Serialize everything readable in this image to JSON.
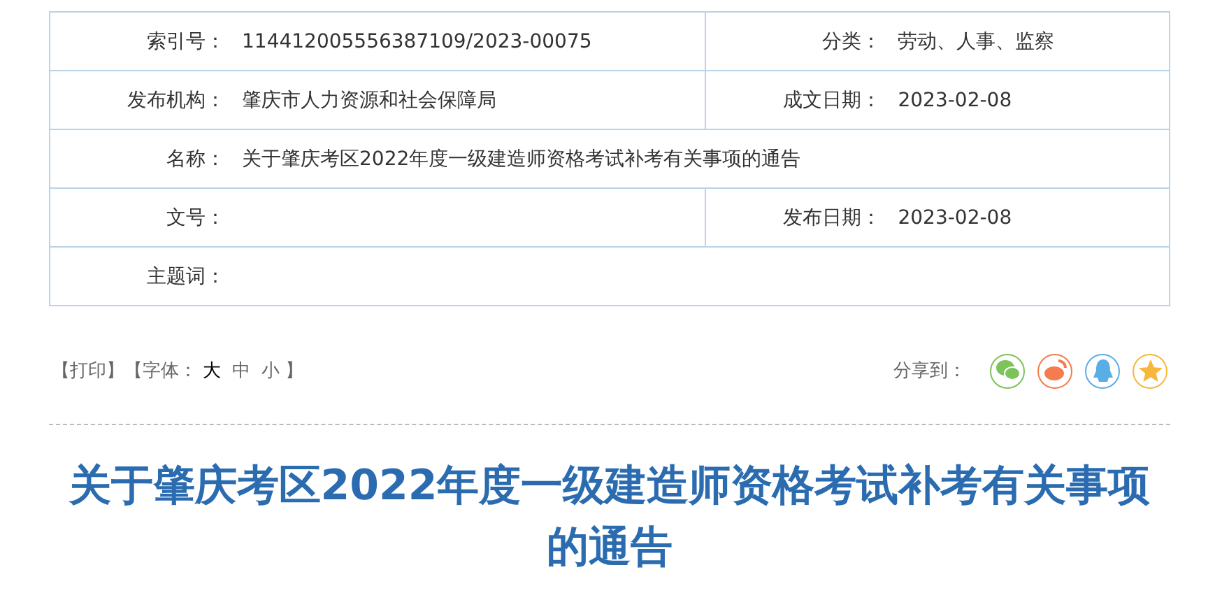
{
  "info_table": {
    "rows": [
      {
        "kind": "pair",
        "cells": [
          {
            "label": "索引号：",
            "value": "114412005556387109/2023-00075"
          },
          {
            "label": "分类：",
            "value": "劳动、人事、监察"
          }
        ]
      },
      {
        "kind": "pair",
        "cells": [
          {
            "label": "发布机构：",
            "value": "肇庆市人力资源和社会保障局"
          },
          {
            "label": "成文日期：",
            "value": "2023-02-08"
          }
        ]
      },
      {
        "kind": "full",
        "cells": [
          {
            "label": "名称：",
            "value": "关于肇庆考区2022年度一级建造师资格考试补考有关事项的通告"
          }
        ]
      },
      {
        "kind": "pair",
        "cells": [
          {
            "label": "文号："
          },
          {
            "label": "发布日期：",
            "value": "2023-02-08"
          }
        ]
      },
      {
        "kind": "full",
        "cells": [
          {
            "label": "主题词："
          }
        ]
      }
    ]
  },
  "tools": {
    "print": "【打印】",
    "font_open": "【字体：",
    "font_sizes": [
      {
        "label": "大",
        "selected": true
      },
      {
        "label": "中",
        "selected": false
      },
      {
        "label": "小",
        "selected": false
      }
    ],
    "font_close": "】"
  },
  "share": {
    "label": "分享到：",
    "targets": [
      {
        "kind": "wechat",
        "color": "#7cc35a"
      },
      {
        "kind": "weibo",
        "color": "#f47c4e"
      },
      {
        "kind": "qq",
        "color": "#5aaee6"
      },
      {
        "kind": "favorite",
        "color": "#f6b73c"
      }
    ]
  },
  "article": {
    "title": "关于肇庆考区2022年度一级建造师资格考试补考有关事项的通告"
  }
}
